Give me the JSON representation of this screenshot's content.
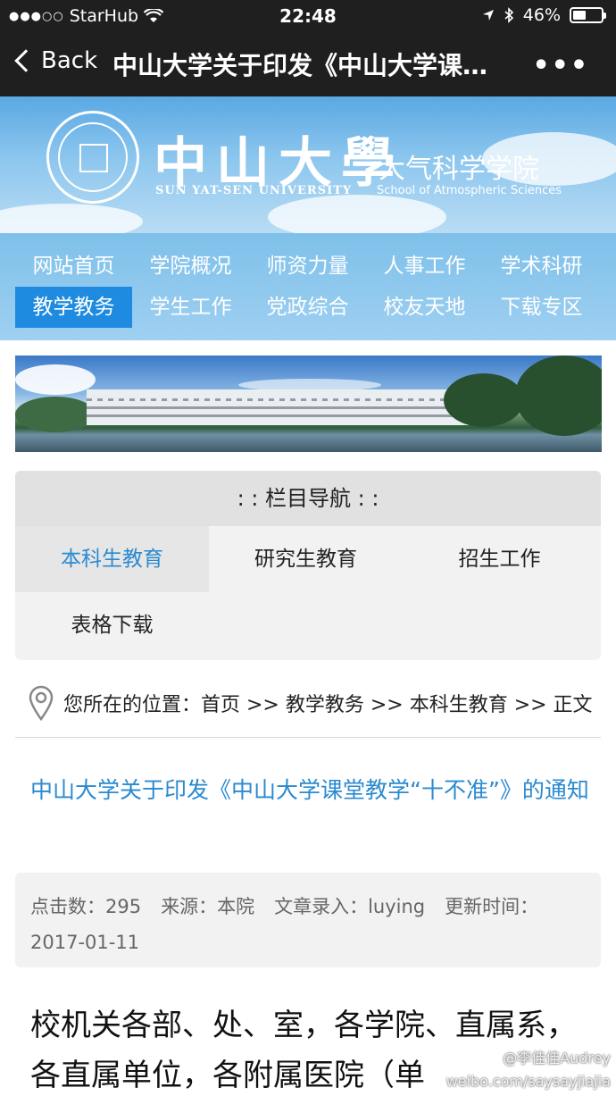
{
  "status_bar": {
    "carrier": "StarHub",
    "time": "22:48",
    "battery": "46%",
    "battery_level": 0.46
  },
  "nav_bar": {
    "back_label": "Back",
    "title": "中山大学关于印发《中山大学课…"
  },
  "header": {
    "university_cn": "中山大學",
    "university_en": "SUN YAT-SEN UNIVERSITY",
    "school_cn": "大气科学学院",
    "school_en": "School of Atmospheric Sciences"
  },
  "menu": {
    "items": [
      {
        "label": "网站首页"
      },
      {
        "label": "学院概况"
      },
      {
        "label": "师资力量"
      },
      {
        "label": "人事工作"
      },
      {
        "label": "学术科研"
      },
      {
        "label": "教学教务",
        "active": true
      },
      {
        "label": "学生工作"
      },
      {
        "label": "党政综合"
      },
      {
        "label": "校友天地"
      },
      {
        "label": "下载专区"
      }
    ]
  },
  "category_nav": {
    "heading": ": : 栏目导航 : :",
    "items": [
      {
        "label": "本科生教育",
        "active": true
      },
      {
        "label": "研究生教育"
      },
      {
        "label": "招生工作"
      },
      {
        "label": "表格下载"
      }
    ]
  },
  "breadcrumb": {
    "text": "您所在的位置：首页 >> 教学教务 >> 本科生教育 >> 正文"
  },
  "article": {
    "title": "中山大学关于印发《中山大学课堂教学“十不准”》的通知",
    "meta": {
      "clicks": "点击数：295",
      "source": "来源：本院",
      "editor": "文章录入：luying",
      "updated": "更新时间：2017-01-11"
    },
    "body": "校机关各部、处、室，各学院、直属系，各直属单位，各附属医院（单"
  },
  "watermark": {
    "line1": "@李佳佳Audrey",
    "line2": "weibo.com/saysayjiajia"
  },
  "colors": {
    "accent_blue": "#2a8ad0",
    "menu_active": "#1e8be0",
    "bar_dark": "#1f1f1f"
  }
}
